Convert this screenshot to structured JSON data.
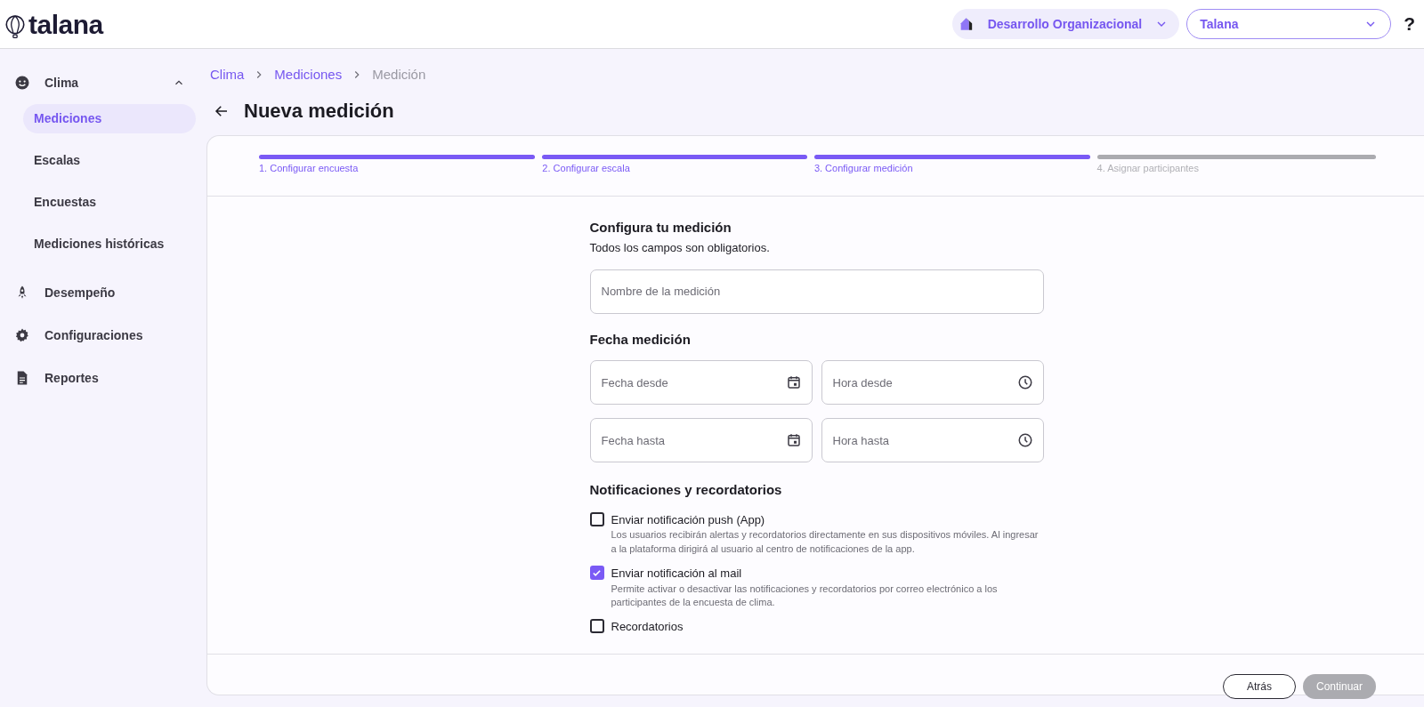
{
  "header": {
    "logo": "talana",
    "org": {
      "label": "Desarrollo Organizacional"
    },
    "company_select": {
      "value": "Talana"
    },
    "help": "?"
  },
  "sidebar": {
    "items": [
      {
        "label": "Clima",
        "expanded": true,
        "children": [
          {
            "label": "Mediciones",
            "selected": true
          },
          {
            "label": "Escalas",
            "selected": false
          },
          {
            "label": "Encuestas",
            "selected": false
          },
          {
            "label": "Mediciones históricas",
            "selected": false
          }
        ]
      },
      {
        "label": "Desempeño"
      },
      {
        "label": "Configuraciones"
      },
      {
        "label": "Reportes"
      }
    ]
  },
  "breadcrumb": [
    {
      "label": "Clima",
      "current": false
    },
    {
      "label": "Mediciones",
      "current": false
    },
    {
      "label": "Medición",
      "current": true
    }
  ],
  "page_title": "Nueva medición",
  "stepper": [
    {
      "label": "1. Configurar encuesta",
      "completed": true
    },
    {
      "label": "2. Configurar escala",
      "completed": true
    },
    {
      "label": "3. Configurar medición",
      "completed": true
    },
    {
      "label": "4. Asignar participantes",
      "completed": false
    }
  ],
  "form": {
    "title": "Configura tu medición",
    "subtitle": "Todos los campos son obligatorios.",
    "name_field": {
      "placeholder": "Nombre de la medición"
    },
    "date_section": "Fecha medición",
    "date_fields": [
      {
        "placeholder": "Fecha desde",
        "kind": "date"
      },
      {
        "placeholder": "Hora desde",
        "kind": "time"
      },
      {
        "placeholder": "Fecha hasta",
        "kind": "date"
      },
      {
        "placeholder": "Hora hasta",
        "kind": "time"
      }
    ],
    "notifications_section": "Notificaciones y recordatorios",
    "options": [
      {
        "label": "Enviar notificación push (App)",
        "description": "Los usuarios recibirán alertas y recordatorios directamente en sus dispositivos móviles. Al ingresar a la plataforma dirigirá al usuario al centro de notificaciones de la app.",
        "checked": false
      },
      {
        "label": "Enviar notificación al mail",
        "description": "Permite activar o desactivar las notificaciones y recordatorios por correo electrónico a los participantes de la encuesta de clima.",
        "checked": true
      },
      {
        "label": "Recordatorios",
        "checked": false
      }
    ]
  },
  "footer_buttons": [
    {
      "label": "Atrás",
      "kind": "outline",
      "disabled": false
    },
    {
      "label": "Continuar",
      "kind": "primary",
      "disabled": true
    }
  ]
}
